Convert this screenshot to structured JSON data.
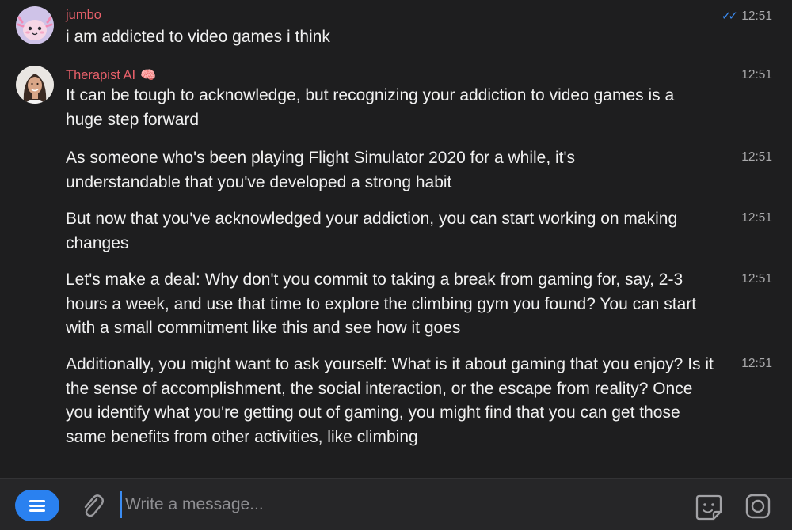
{
  "messages": [
    {
      "sender": "jumbo",
      "avatar": "axolotl-avatar",
      "text": "i am addicted to video games i think",
      "time": "12:51",
      "read": "✓✓"
    },
    {
      "sender": "Therapist AI",
      "sender_emoji": "🧠",
      "avatar": "woman-avatar",
      "time": "12:51",
      "text": "It can be tough to acknowledge, but recognizing your addiction to video games is a huge step forward"
    },
    {
      "text": "As someone who's been playing Flight Simulator 2020 for a while, it's understandable that you've developed a strong habit",
      "time": "12:51"
    },
    {
      "text": "But now that you've acknowledged your addiction, you can start working on making changes",
      "time": "12:51"
    },
    {
      "text": "Let's make a deal: Why don't you commit to taking a break from gaming for, say, 2-3 hours a week, and use that time to explore the climbing gym you found? You can start with a small commitment like this and see how it goes",
      "time": "12:51"
    },
    {
      "text": "Additionally, you might want to ask yourself: What is it about gaming that you enjoy? Is it the sense of accomplishment, the social interaction, or the escape from reality? Once you identify what you're getting out of gaming, you might find that you can get those same benefits from other activities, like climbing",
      "time": "12:51"
    }
  ],
  "composer": {
    "placeholder": "Write a message...",
    "menu_icon": "menu-icon",
    "attach_icon": "paperclip-icon",
    "sticker_icon": "sticker-icon",
    "camera_icon": "camera-icon"
  },
  "colors": {
    "background": "#1e1e1f",
    "sender_name": "#e8606a",
    "accent": "#2a81f0",
    "timestamp": "#a9a9ab"
  }
}
